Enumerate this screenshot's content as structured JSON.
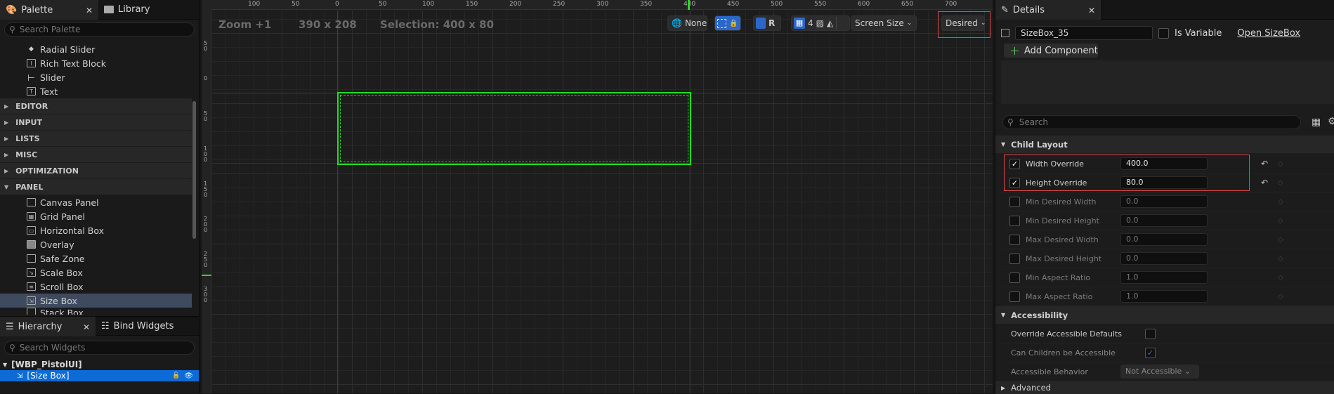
{
  "palette": {
    "tabs": {
      "palette": "Palette",
      "library": "Library"
    },
    "search_placeholder": "Search Palette",
    "top_items": [
      {
        "label": "Radial Slider",
        "icon": "dot-icon"
      },
      {
        "label": "Rich Text Block",
        "icon": "richtext-icon"
      },
      {
        "label": "Slider",
        "icon": "slider-icon"
      },
      {
        "label": "Text",
        "icon": "text-icon"
      }
    ],
    "categories": [
      "EDITOR",
      "INPUT",
      "LISTS",
      "MISC",
      "OPTIMIZATION",
      "PANEL"
    ],
    "panel_items": [
      "Canvas Panel",
      "Grid Panel",
      "Horizontal Box",
      "Overlay",
      "Safe Zone",
      "Scale Box",
      "Scroll Box",
      "Size Box",
      "Stack Box"
    ]
  },
  "hierarchy": {
    "tabs": {
      "hierarchy": "Hierarchy",
      "bind": "Bind Widgets"
    },
    "search_placeholder": "Search Widgets",
    "root": "[WBP_PistolUI]",
    "child": "[Size Box]"
  },
  "canvas": {
    "zoom": "Zoom +1",
    "resolution": "390 x 208",
    "selection": "Selection: 400 x 80",
    "toolbar": {
      "none": "None",
      "r": "R",
      "grid_num": "4",
      "screen_size": "Screen Size",
      "desired": "Desired"
    },
    "ruler_top": [
      "100",
      "50",
      "0",
      "50",
      "100",
      "150",
      "200",
      "250",
      "300",
      "350",
      "400",
      "450",
      "500",
      "550",
      "600",
      "650",
      "700"
    ],
    "ruler_left": [
      "5\n0",
      "0",
      "5\n0",
      "1\n0\n0",
      "1\n5\n0",
      "2\n0\n0",
      "2\n5\n0",
      "3\n0\n0"
    ]
  },
  "details": {
    "tab": "Details",
    "name": "SizeBox_35",
    "is_variable": "Is Variable",
    "open_link": "Open SizeBox",
    "add_component": "Add Component",
    "search_placeholder": "Search",
    "child_layout": "Child Layout",
    "props": [
      {
        "label": "Width Override",
        "value": "400.0",
        "checked": true
      },
      {
        "label": "Height Override",
        "value": "80.0",
        "checked": true
      },
      {
        "label": "Min Desired Width",
        "value": "0.0",
        "checked": false
      },
      {
        "label": "Min Desired Height",
        "value": "0.0",
        "checked": false
      },
      {
        "label": "Max Desired Width",
        "value": "0.0",
        "checked": false
      },
      {
        "label": "Max Desired Height",
        "value": "0.0",
        "checked": false
      },
      {
        "label": "Min Aspect Ratio",
        "value": "1.0",
        "checked": false
      },
      {
        "label": "Max Aspect Ratio",
        "value": "1.0",
        "checked": false
      }
    ],
    "accessibility": "Accessibility",
    "acc_props": [
      {
        "label": "Override Accessible Defaults"
      },
      {
        "label": "Can Children be Accessible"
      },
      {
        "label": "Accessible Behavior",
        "value": "Not Accessible"
      }
    ],
    "advanced": "Advanced"
  },
  "colors": {
    "accent": "#2b67c8",
    "selection": "#22dd22",
    "highlight": "#e04848"
  }
}
